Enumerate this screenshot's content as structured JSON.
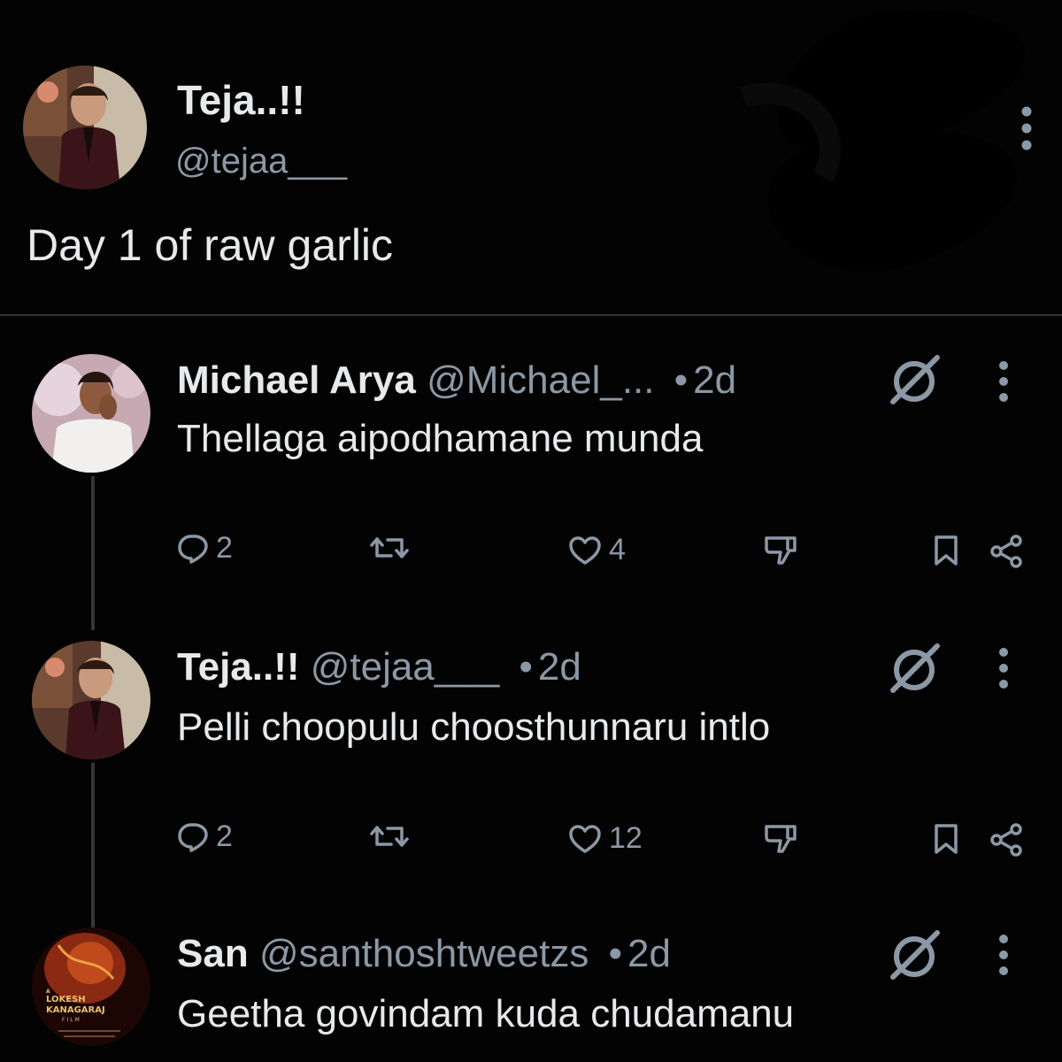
{
  "main_tweet": {
    "name": "Teja..!!",
    "handle": "@tejaa___",
    "text": "Day 1 of raw garlic"
  },
  "replies": [
    {
      "name": "Michael Arya",
      "handle": "@Michael_...",
      "time": "2d",
      "text": "Thellaga aipodhamane munda",
      "replies": "2",
      "retweets": "",
      "likes": "4"
    },
    {
      "name": "Teja..!!",
      "handle": "@tejaa___",
      "time": "2d",
      "text": "Pelli choopulu choosthunnaru intlo",
      "replies": "2",
      "retweets": "",
      "likes": "12"
    },
    {
      "name": "San",
      "handle": "@santhoshtweetzs",
      "time": "2d",
      "text": "Geetha govindam kuda chudamanu"
    }
  ],
  "separator": "•",
  "avatar_logo_lines": [
    "A",
    "LOKESH",
    "KANAGARAJ",
    "FILM"
  ],
  "colors": {
    "background": "#030303",
    "text": "#e7e9ea",
    "secondary": "#8b98a5",
    "divider": "#2f3336",
    "thread_line": "#333639"
  },
  "icons": [
    "more-icon",
    "grok-icon",
    "reply-icon",
    "retweet-icon",
    "like-icon",
    "dislike-icon",
    "bookmark-icon",
    "share-icon"
  ]
}
